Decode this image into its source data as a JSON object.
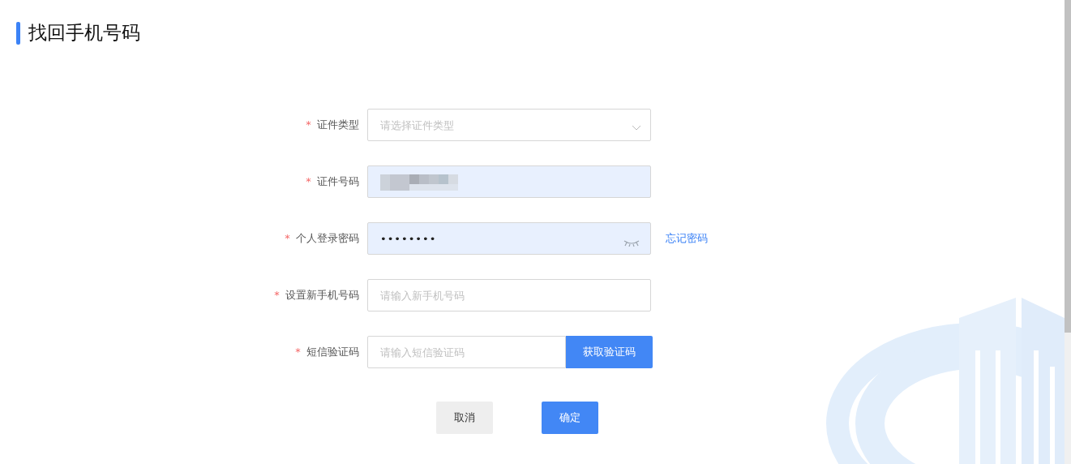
{
  "page": {
    "title": "找回手机号码"
  },
  "fields": [
    {
      "kind": "select",
      "label": "证件类型",
      "required_mark": "*",
      "placeholder": "请选择证件类型"
    },
    {
      "kind": "redacted",
      "label": "证件号码",
      "required_mark": "*",
      "autofilled": true
    },
    {
      "kind": "password",
      "label": "个人登录密码",
      "required_mark": "*",
      "value": "••••••••",
      "autofilled": true,
      "link": "忘记密码"
    },
    {
      "kind": "text",
      "label": "设置新手机号码",
      "required_mark": "*",
      "placeholder": "请输入新手机号码"
    },
    {
      "kind": "sms",
      "label": "短信验证码",
      "required_mark": "*",
      "placeholder": "请输入短信验证码",
      "button": "获取验证码"
    }
  ],
  "buttons": [
    {
      "kind": "secondary",
      "label": "取消"
    },
    {
      "kind": "primary",
      "label": "确定"
    }
  ]
}
